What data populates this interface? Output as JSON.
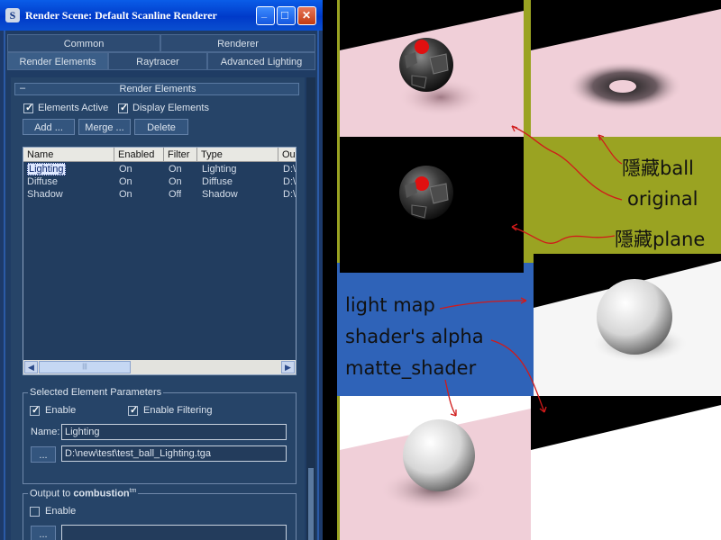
{
  "window": {
    "icon": "S",
    "title": "Render Scene: Default Scanline Renderer",
    "controls": {
      "minimize": "_",
      "maximize": "□",
      "close": "✕"
    }
  },
  "tabs": {
    "row1": [
      "Common",
      "Renderer"
    ],
    "row2": [
      "Render Elements",
      "Raytracer",
      "Advanced Lighting"
    ]
  },
  "rollout": {
    "collapse": "–",
    "title": "Render Elements"
  },
  "options": {
    "elements_active": {
      "label": "Elements Active",
      "checked": true
    },
    "display_elements": {
      "label": "Display Elements",
      "checked": true
    }
  },
  "buttons": {
    "add": "Add ...",
    "merge": "Merge ...",
    "delete": "Delete"
  },
  "list": {
    "columns": [
      "Name",
      "Enabled",
      "Filter",
      "Type",
      "Ou"
    ],
    "rows": [
      {
        "name": "Lighting",
        "enabled": "On",
        "filter": "On",
        "type": "Lighting",
        "out": "D:\\"
      },
      {
        "name": "Diffuse",
        "enabled": "On",
        "filter": "On",
        "type": "Diffuse",
        "out": "D:\\"
      },
      {
        "name": "Shadow",
        "enabled": "On",
        "filter": "Off",
        "type": "Shadow",
        "out": "D:\\"
      }
    ],
    "selected_row": 0
  },
  "scrollbar": {
    "left": "◀",
    "right": "▶",
    "grip": "|||"
  },
  "selected_params": {
    "title": "Selected Element Parameters",
    "enable": {
      "label": "Enable",
      "checked": true
    },
    "enable_filtering": {
      "label": "Enable Filtering",
      "checked": true
    },
    "name_label": "Name:",
    "name_value": "Lighting",
    "browse": "...",
    "path": "D:\\new\\test\\test_ball_Lighting.tga"
  },
  "combustion": {
    "title_prefix": "Output to ",
    "title_bold": "combustion",
    "tm": "tm",
    "enable": {
      "label": "Enable",
      "checked": false
    },
    "browse": "..."
  },
  "annotations": {
    "hide_ball": "隱藏ball",
    "original": "original",
    "hide_plane": "隱藏plane",
    "light_map": "light map",
    "shaders_alpha": "shader's alpha",
    "matte_shader": "matte_shader"
  },
  "colors": {
    "annotation_on_olive": "#111111",
    "annotation_on_blue": "#111111",
    "arrow": "#d11a1a",
    "olive_bg": "#9aa322",
    "blue_bg": "#2f63b8",
    "pink_plane": "#f0cfd8",
    "ball_marker": "#e01010"
  }
}
